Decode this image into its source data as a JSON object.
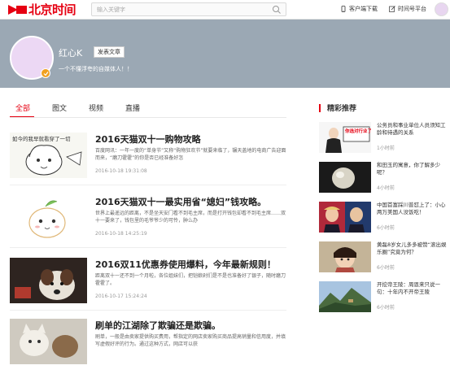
{
  "header": {
    "logo_text": "北京时间",
    "search_placeholder": "输入关键字",
    "client_download": "客户端下载",
    "platform_link": "时间号平台"
  },
  "profile": {
    "name": "红心K",
    "publish_button": "发表文章",
    "description": "一个不懂浮夸的自媒体人！！"
  },
  "tabs": [
    {
      "label": "全部",
      "active": true
    },
    {
      "label": "图文",
      "active": false
    },
    {
      "label": "视频",
      "active": false
    },
    {
      "label": "直播",
      "active": false
    }
  ],
  "articles": [
    {
      "title": "2016天猫双十一购物攻略",
      "desc": "百度网讯：一年一度的“单身节”又称“购物狂欢节”就要来临了，辗天盖地的电商广告迎面而来，“磨刀霍霍”的你是否已经准备好怎",
      "date": "2016-10-18 19:31:08",
      "thumb_caption": "如今的我早就看穿了一切"
    },
    {
      "title": "2016天猫双十一最实用省“媳妇”钱攻略。",
      "desc": "世界上最遥远的距离，不是坐天安门看不到毛主席，而是打开钱包却看不到毛主席……双十一要来了，钱包里的毛爷爷少的可怜，肿么办",
      "date": "2016-10-18 14:25:19",
      "thumb_caption": ""
    },
    {
      "title": "2016双11优惠券使用爆料，今年最新规则！",
      "desc": "距离双十一还不到一个月啦，各位姐妹们，把铠娘剁们是不是也准备好了银子，随时磨刀霍霍了。",
      "date": "2016-10-17 15:24:24",
      "thumb_caption": ""
    },
    {
      "title": "刷单的江湖除了欺骗还是欺骗。",
      "desc": "刷单，一般是由卖家提供购买费用，帮指定的网店卖家购买商品提高销量和信用度，并填写虚假好评的行为。通过这种方式，网店可以获",
      "date": "",
      "thumb_caption": ""
    }
  ],
  "recommend": {
    "title": "精彩推荐",
    "items": [
      {
        "text": "公务员和事业单位人员须知工龄和待遇的关系",
        "time": "1小时前",
        "thumb_caption": "你选对行业了吗？"
      },
      {
        "text": "和田玉的寓意，你了解多少呢？",
        "time": "4小时前",
        "thumb_caption": ""
      },
      {
        "text": "中国首富踩川普怼上了：小心两万美国人没饭吃！",
        "time": "6小时前",
        "thumb_caption": ""
      },
      {
        "text": "黄磊8岁女儿多多被赞“滚出娱乐圈”究竟为何？",
        "time": "6小时前",
        "thumb_caption": ""
      },
      {
        "text": "开挖帝王陵：周恩来只说一句：十年内不开帝王陵",
        "time": "6小时前",
        "thumb_caption": ""
      }
    ]
  },
  "colors": {
    "brand": "#e60012",
    "banner": "#9ba8b4",
    "badge": "#f0a020"
  }
}
